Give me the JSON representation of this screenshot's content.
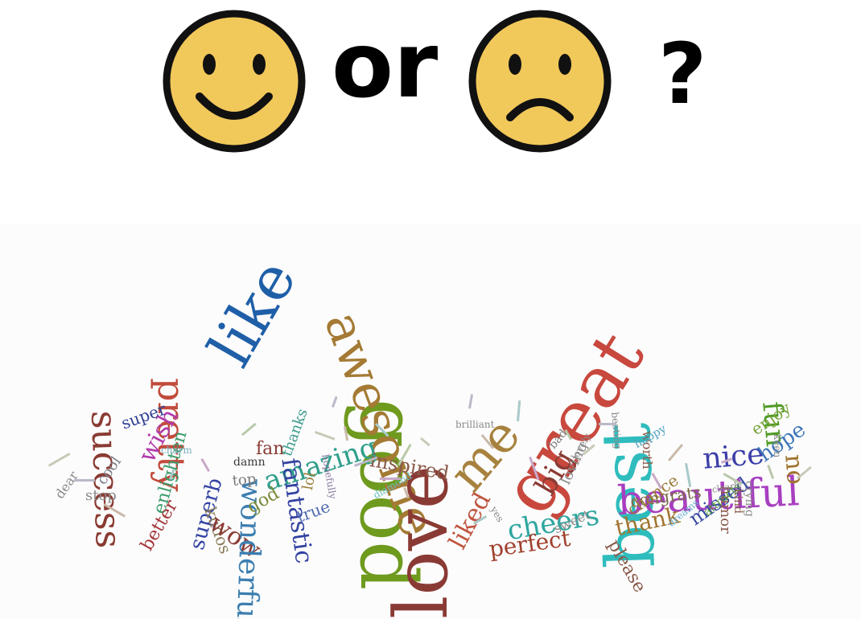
{
  "header": {
    "left_face": "smiling-face",
    "right_face": "frowning-face",
    "connector": "or",
    "question_mark": "?",
    "face_color": "#f1c85a"
  },
  "word_cloud": {
    "words": [
      {
        "text": "like",
        "color": "#1f5fa8"
      },
      {
        "text": "good",
        "color": "#6e9a1e"
      },
      {
        "text": "awesome",
        "color": "#a47a34"
      },
      {
        "text": "love",
        "color": "#8a3a34"
      },
      {
        "text": "me",
        "color": "#a7823e"
      },
      {
        "text": "great",
        "color": "#c8483e"
      },
      {
        "text": "best",
        "color": "#2fbcbd"
      },
      {
        "text": "beautiful",
        "color": "#a73fc0"
      },
      {
        "text": "fun",
        "color": "#4f9a24"
      },
      {
        "text": "no",
        "color": "#a0742e"
      },
      {
        "text": "nice",
        "color": "#3b3ea8"
      },
      {
        "text": "hope",
        "color": "#3f77b9"
      },
      {
        "text": "enjoy",
        "color": "#76a43a"
      },
      {
        "text": "pretty",
        "color": "#c14b3c"
      },
      {
        "text": "success",
        "color": "#8a3b32"
      },
      {
        "text": "wish",
        "color": "#b13cab"
      },
      {
        "text": "super",
        "color": "#2f3f93"
      },
      {
        "text": "cool",
        "color": "#7b7f88"
      },
      {
        "text": "stop",
        "color": "#8a8a8a"
      },
      {
        "text": "dear",
        "color": "#8a8a8a"
      },
      {
        "text": "enlighten",
        "color": "#3b9c6a"
      },
      {
        "text": "better",
        "color": "#a3373b"
      },
      {
        "text": "superb",
        "color": "#3443a3"
      },
      {
        "text": "kudos",
        "color": "#8a7a5a"
      },
      {
        "text": "wow",
        "color": "#8a3b34"
      },
      {
        "text": "amazing",
        "color": "#2f9e8a"
      },
      {
        "text": "wonderful",
        "color": "#3c7eb0"
      },
      {
        "text": "fantastic",
        "color": "#3342a1"
      },
      {
        "text": "fan",
        "color": "#8a3b34"
      },
      {
        "text": "thanks",
        "color": "#3c9c8c"
      },
      {
        "text": "lol",
        "color": "#9a7f3a"
      },
      {
        "text": "true",
        "color": "#4f6bb0"
      },
      {
        "text": "god",
        "color": "#7a8a3a"
      },
      {
        "text": "top",
        "color": "#7a7a7a"
      },
      {
        "text": "damn",
        "color": "#3a3a3a"
      },
      {
        "text": "inspired",
        "color": "#8a5a4a"
      },
      {
        "text": "liked",
        "color": "#c0553f"
      },
      {
        "text": "big",
        "color": "#8a3b34"
      },
      {
        "text": "cheers",
        "color": "#2fa6a0"
      },
      {
        "text": "perfect",
        "color": "#a0402e"
      },
      {
        "text": "thank",
        "color": "#a0742e"
      },
      {
        "text": "congrats",
        "color": "#7a6a4a"
      },
      {
        "text": "chance",
        "color": "#9a7a3a"
      },
      {
        "text": "missed",
        "color": "#3a4aa3"
      },
      {
        "text": "please",
        "color": "#8a5a4a"
      },
      {
        "text": "loving",
        "color": "#8a8a8a"
      },
      {
        "text": "sweet",
        "color": "#8a8a8a"
      },
      {
        "text": "humor",
        "color": "#8a5a4a"
      },
      {
        "text": "worth",
        "color": "#8a5a4a"
      },
      {
        "text": "happy",
        "color": "#4fa3c0"
      },
      {
        "text": "beating",
        "color": "#8a8a8a"
      },
      {
        "text": "kind",
        "color": "#8a5a4a"
      },
      {
        "text": "crying",
        "color": "#8a8a8a"
      },
      {
        "text": "attracts",
        "color": "#4f9a3a"
      },
      {
        "text": "dreams",
        "color": "#6aaed0"
      },
      {
        "text": "diamond",
        "color": "#6ac0c0"
      },
      {
        "text": "brilliant",
        "color": "#8a8a8a"
      },
      {
        "text": "charm",
        "color": "#7ab0c0"
      },
      {
        "text": "hopefully",
        "color": "#8a7aa0"
      },
      {
        "text": "keen",
        "color": "#8a8a8a"
      },
      {
        "text": "clearly",
        "color": "#8a8a8a"
      },
      {
        "text": "bad",
        "color": "#7a7a7a"
      },
      {
        "text": "lovely",
        "color": "#8a8a8a"
      },
      {
        "text": "yes",
        "color": "#8a8a8a"
      }
    ]
  }
}
